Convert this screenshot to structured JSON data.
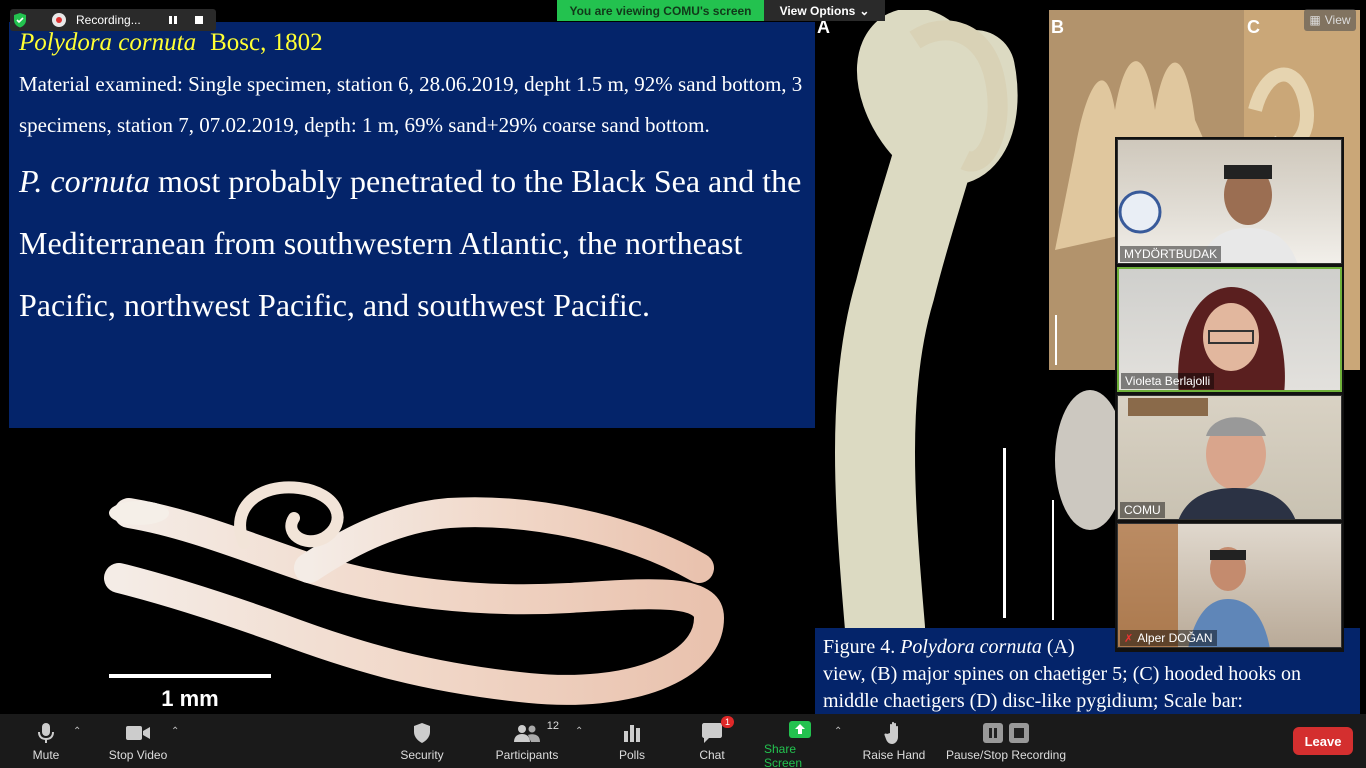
{
  "recording": {
    "label": "Recording..."
  },
  "banner": {
    "viewing_text": "You are viewing COMU's screen",
    "view_options": "View Options"
  },
  "view_button": {
    "label": "View"
  },
  "slide": {
    "species": "Polydora cornuta",
    "author": "Bosc, 1802",
    "material": "Material examined: Single specimen, station 6, 28.06.2019, depht 1.5 m, 92% sand bottom, 3 specimens, station 7, 07.02.2019, depth: 1 m, 69% sand+29% coarse sand bottom.",
    "penetration_species": "P. cornuta",
    "penetration_text": " most probably penetrated to the Black Sea and the Mediterranean from southwestern Atlantic, the northeast Pacific, northwest Pacific, and southwest Pacific.",
    "scale_bar": "1 mm"
  },
  "figure": {
    "labels": [
      "A",
      "B",
      "C"
    ],
    "caption_prefix": "Figure 4. ",
    "caption_species": "Polydora cornuta",
    "caption_rest": " (A) ",
    "caption_line2": "view, (B) major spines on chaetiger 5; (C) hooded hooks on middle chaetigers (D) disc-like pygidium; Scale bar:"
  },
  "participants": [
    {
      "name": "MYDÖRTBUDAK",
      "muted": false
    },
    {
      "name": "Violeta Berlajolli",
      "muted": false
    },
    {
      "name": "COMU",
      "muted": false
    },
    {
      "name": "Alper DOĞAN",
      "muted": true
    }
  ],
  "toolbar": {
    "mute": "Mute",
    "stop_video": "Stop Video",
    "security": "Security",
    "participants": "Participants",
    "participants_count": "12",
    "polls": "Polls",
    "chat": "Chat",
    "chat_badge": "1",
    "share_screen": "Share Screen",
    "raise_hand": "Raise Hand",
    "pause_stop": "Pause/Stop Recording",
    "leave": "Leave"
  }
}
